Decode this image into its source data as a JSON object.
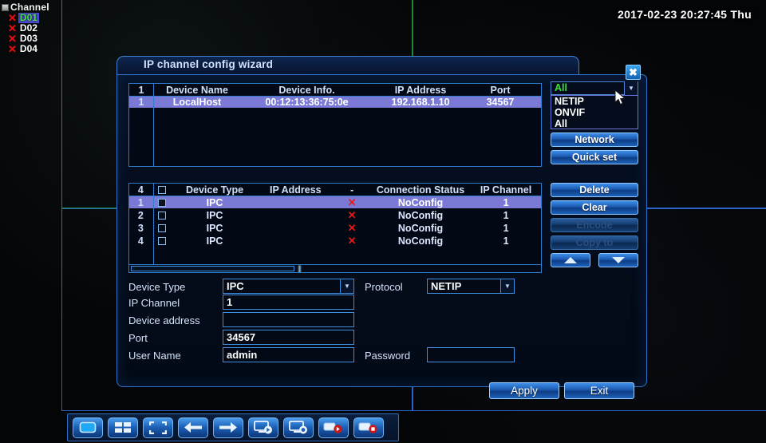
{
  "clock": {
    "datetime": "2017-02-23 20:27:45 Thu"
  },
  "channel_panel": {
    "title": "Channel",
    "title_icon": "monitor-icon",
    "items": [
      {
        "label": "D01",
        "status_icon": "red-x-icon",
        "active": true
      },
      {
        "label": "D02",
        "status_icon": "red-x-icon",
        "active": false
      },
      {
        "label": "D03",
        "status_icon": "red-x-icon",
        "active": false
      },
      {
        "label": "D04",
        "status_icon": "red-x-icon",
        "active": false
      }
    ]
  },
  "dialog": {
    "title": "IP channel config wizard",
    "close_icon": "close-icon",
    "device_table": {
      "count": "1",
      "headers": [
        "1",
        "Device Name",
        "Device Info.",
        "IP Address",
        "Port"
      ],
      "rows": [
        {
          "idx": "1",
          "name": "LocalHost",
          "info": "00:12:13:36:75:0e",
          "ip": "192.168.1.10",
          "port": "34567",
          "selected": true
        }
      ]
    },
    "protocol_filter": {
      "selected": "All",
      "options": [
        "NETIP",
        "ONVIF",
        "All"
      ],
      "expanded": true,
      "arrow_icon": "chevron-down-icon"
    },
    "side_buttons_top": [
      {
        "label": "Network",
        "enabled": true
      },
      {
        "label": "Quick set",
        "enabled": true
      }
    ],
    "channel_table": {
      "count": "4",
      "headers": [
        "4",
        "",
        "Device Type",
        "IP Address",
        "-",
        "Connection Status",
        "IP Channel"
      ],
      "rows": [
        {
          "idx": "1",
          "checked": true,
          "type": "IPC",
          "ip": "",
          "dash": "x",
          "status": "NoConfig",
          "channel": "1",
          "selected": true
        },
        {
          "idx": "2",
          "checked": false,
          "type": "IPC",
          "ip": "",
          "dash": "x",
          "status": "NoConfig",
          "channel": "1",
          "selected": false
        },
        {
          "idx": "3",
          "checked": false,
          "type": "IPC",
          "ip": "",
          "dash": "x",
          "status": "NoConfig",
          "channel": "1",
          "selected": false
        },
        {
          "idx": "4",
          "checked": false,
          "type": "IPC",
          "ip": "",
          "dash": "x",
          "status": "NoConfig",
          "channel": "1",
          "selected": false
        }
      ]
    },
    "side_buttons_bottom": [
      {
        "label": "Delete",
        "enabled": true
      },
      {
        "label": "Clear",
        "enabled": true
      },
      {
        "label": "Encode",
        "enabled": false
      },
      {
        "label": "Copy to",
        "enabled": false
      }
    ],
    "nav_buttons": [
      {
        "icon": "arrow-up-icon"
      },
      {
        "icon": "arrow-down-icon"
      }
    ],
    "form": {
      "device_type": {
        "label": "Device Type",
        "value": "IPC",
        "placeholder": ""
      },
      "protocol": {
        "label": "Protocol",
        "value": "NETIP",
        "placeholder": ""
      },
      "ip_channel": {
        "label": "IP Channel",
        "value": "1",
        "placeholder": ""
      },
      "device_address": {
        "label": "Device address",
        "value": "",
        "placeholder": ""
      },
      "port": {
        "label": "Port",
        "value": "34567",
        "placeholder": ""
      },
      "user_name": {
        "label": "User Name",
        "value": "admin",
        "placeholder": ""
      },
      "password": {
        "label": "Password",
        "value": "",
        "placeholder": ""
      }
    },
    "footer_buttons": [
      {
        "label": "Apply"
      },
      {
        "label": "Exit"
      }
    ]
  },
  "taskbar": {
    "items": [
      {
        "icon": "single-view-icon",
        "active": true
      },
      {
        "icon": "quad-view-icon",
        "active": false
      },
      {
        "icon": "fullscreen-icon",
        "active": false
      },
      {
        "icon": "arrow-left-icon",
        "active": false
      },
      {
        "icon": "arrow-right-icon",
        "active": false
      },
      {
        "icon": "playback-icon",
        "active": false
      },
      {
        "icon": "monitor-record-icon",
        "active": false
      },
      {
        "icon": "record-play-icon",
        "active": false
      },
      {
        "icon": "record-stop-icon",
        "active": false
      }
    ]
  },
  "colors": {
    "accent_blue": "#2f72c8",
    "selection": "#7a7ad6",
    "status_red": "#e21a1a",
    "selected_green": "#3ee03e",
    "quad_border_green": "#1f8a2f",
    "quad_border_blue": "#2b63c9"
  }
}
